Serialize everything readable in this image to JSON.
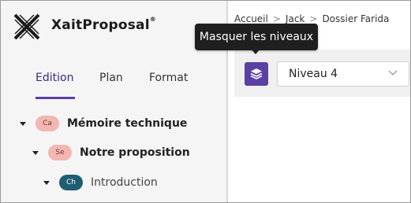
{
  "app": {
    "name": "XaitProposal",
    "trademark": "®"
  },
  "sidebar": {
    "tabs": [
      {
        "label": "Edition",
        "active": true
      },
      {
        "label": "Plan",
        "active": false
      },
      {
        "label": "Format",
        "active": false
      }
    ],
    "tree": [
      {
        "badge": "Ca",
        "label": "Mémoire technique"
      },
      {
        "badge": "Se",
        "label": "Notre proposition"
      },
      {
        "badge": "Ch",
        "label": "Introduction"
      }
    ]
  },
  "breadcrumb": {
    "items": [
      "Accueil",
      "Jack",
      "Dossier Farida"
    ],
    "separator": ">"
  },
  "toolbar": {
    "layers_icon": "layers-icon",
    "level_select": {
      "value": "Niveau 4"
    }
  },
  "tooltip": {
    "text": "Masquer les niveaux"
  },
  "colors": {
    "accent": "#5b3fa3",
    "badge_pink": "#f3b6b0",
    "badge_teal": "#1f5d73"
  }
}
